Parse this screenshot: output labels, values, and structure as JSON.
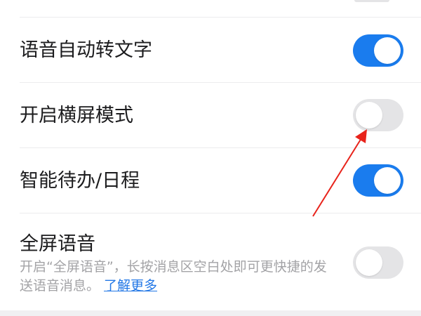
{
  "settings": {
    "voice_to_text": {
      "label": "语音自动转文字",
      "enabled": true
    },
    "landscape_mode": {
      "label": "开启横屏模式",
      "enabled": false
    },
    "smart_todo": {
      "label": "智能待办/日程",
      "enabled": true
    },
    "fullscreen_voice": {
      "label": "全屏语音",
      "description": "开启“全屏语音”，长按消息区空白处即可更快捷的发送语音消息。",
      "learn_more": "了解更多",
      "enabled": false
    }
  },
  "colors": {
    "toggle_on": "#1a7cee",
    "toggle_off": "#e4e4e6",
    "link": "#2277e6",
    "annotation_arrow": "#e8231b"
  }
}
